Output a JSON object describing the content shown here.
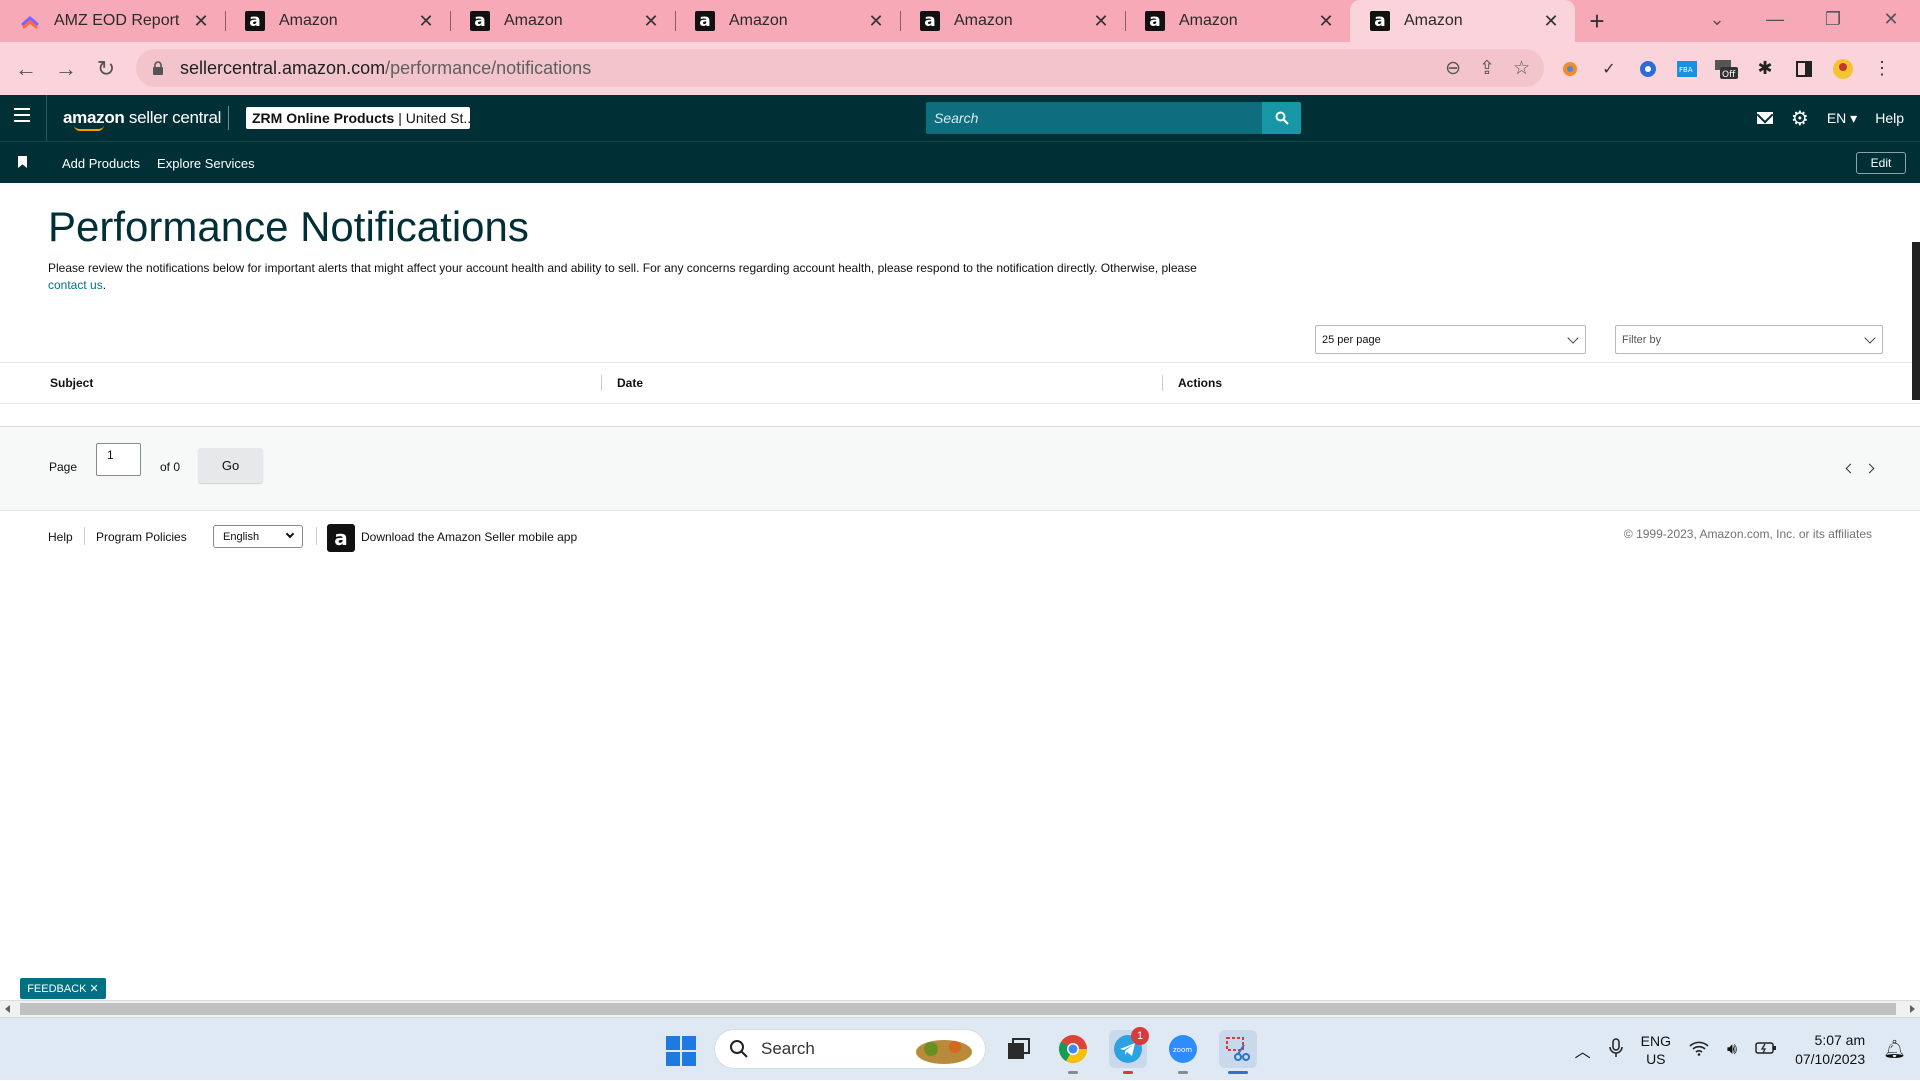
{
  "browser": {
    "tabs": [
      {
        "title": "AMZ EOD Report",
        "favicon": "clickup-icon",
        "active": false
      },
      {
        "title": "Amazon",
        "favicon": "amazon-icon",
        "active": false
      },
      {
        "title": "Amazon",
        "favicon": "amazon-icon",
        "active": false
      },
      {
        "title": "Amazon",
        "favicon": "amazon-icon",
        "active": false
      },
      {
        "title": "Amazon",
        "favicon": "amazon-icon",
        "active": false
      },
      {
        "title": "Amazon",
        "favicon": "amazon-icon",
        "active": false
      },
      {
        "title": "Amazon",
        "favicon": "amazon-icon",
        "active": true
      }
    ],
    "url_host": "sellercentral.amazon.com",
    "url_path": "/performance/notifications",
    "tab_strip_color": "#f7a9b8",
    "toolbar_color": "#fbd3da"
  },
  "header": {
    "logo_bold": "amazon",
    "logo_rest": " seller central",
    "account_name": "ZRM Online Products",
    "account_market": "United St...",
    "search_placeholder": "Search",
    "language": "EN",
    "help": "Help",
    "brand_color": "#002f36"
  },
  "nav": {
    "links": [
      "Add Products",
      "Explore Services"
    ],
    "edit": "Edit"
  },
  "page": {
    "title": "Performance Notifications",
    "intro": "Please review the notifications below for important alerts that might affect your account health and ability to sell. For any concerns regarding account health, please respond to the notification directly. Otherwise, please",
    "contact_link": "contact us",
    "intro_end": ".",
    "per_page": "25 per page",
    "filter_by": "Filter by"
  },
  "table": {
    "columns": [
      "Subject",
      "Date",
      "Actions"
    ],
    "rows": []
  },
  "pager": {
    "page_label": "Page",
    "page_value": "1",
    "of_label": "of 0",
    "go": "Go"
  },
  "footer": {
    "help": "Help",
    "policies": "Program Policies",
    "language": "English",
    "app_text": "Download the Amazon Seller mobile app",
    "copyright": "© 1999-2023, Amazon.com, Inc. or its affiliates"
  },
  "feedback": "FEEDBACK",
  "taskbar": {
    "search": "Search",
    "telegram_badge": "1",
    "lang_line1": "ENG",
    "lang_line2": "US",
    "time": "5:07 am",
    "date": "07/10/2023"
  }
}
